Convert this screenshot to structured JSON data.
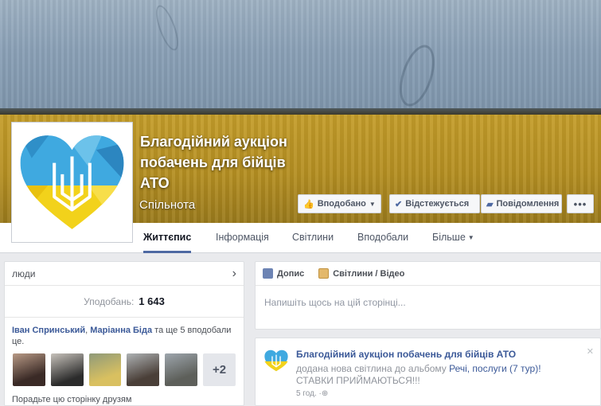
{
  "page": {
    "name": "Благодійний аукціон побачень для бійців АТО",
    "category": "Спільнота"
  },
  "cover_buttons": {
    "liked": "Вподобано",
    "follow": "Відстежується",
    "message": "Повідомлення",
    "more": "•••"
  },
  "tabs": [
    {
      "label": "Життєпис"
    },
    {
      "label": "Інформація"
    },
    {
      "label": "Світлини"
    },
    {
      "label": "Вподобали"
    },
    {
      "label": "Більше"
    }
  ],
  "people": {
    "header": "люди",
    "likes_label": "Уподобань:",
    "likes_count": "1 643",
    "friend1": "Іван Спринський",
    "separator": ", ",
    "friend2": "Маріанна Біда",
    "friends_suffix": " та ще 5 вподобали це.",
    "more_count": "+2",
    "invite_text": "Порадьте цю сторінку друзям"
  },
  "composer": {
    "tab_status": "Допис",
    "tab_photo": "Світлини / Відео",
    "placeholder": "Напишіть щось на цій сторінці..."
  },
  "post": {
    "author": "Благодійний аукціон побачень для бійців АТО",
    "text_prefix": "додана нова світлина до альбому ",
    "album": "Речі, послуги (7 тур)!",
    "text_suffix": "СТАВКИ ПРИЙМАЮТЬСЯ!!!",
    "time": "5 год."
  },
  "colors": {
    "accent": "#4e69a2",
    "link": "#3b5998",
    "heart_blue": "#3fa9e0",
    "heart_yellow": "#f2d21b"
  },
  "icons": [
    "thumbs-up-icon",
    "caret-down-icon",
    "check-icon",
    "message-icon",
    "chevron-right-icon",
    "globe-icon",
    "close-icon"
  ]
}
